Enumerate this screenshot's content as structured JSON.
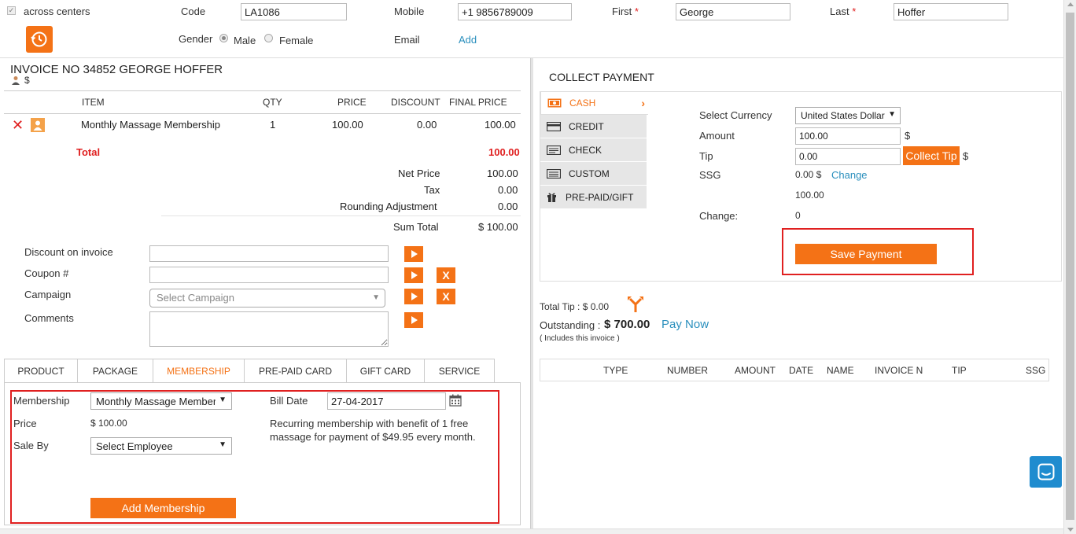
{
  "top": {
    "across_centers": "across centers",
    "code_label": "Code",
    "code_value": "LA1086",
    "mobile_label": "Mobile",
    "mobile_value": "+1 9856789009",
    "first_label": "First",
    "first_value": "George",
    "last_label": "Last",
    "last_value": "Hoffer",
    "required_mark": "*",
    "gender_label": "Gender",
    "male_label": "Male",
    "female_label": "Female",
    "email_label": "Email",
    "email_add": "Add"
  },
  "invoice": {
    "title": "INVOICE NO 34852  GEORGE HOFFER",
    "currency_symbol": "$",
    "columns": [
      "ITEM",
      "QTY",
      "PRICE",
      "DISCOUNT",
      "FINAL PRICE"
    ],
    "row": {
      "item": "Monthly Massage Membership",
      "qty": "1",
      "price": "100.00",
      "discount": "0.00",
      "final": "100.00"
    },
    "total_label": "Total",
    "total_value": "100.00",
    "net_price_label": "Net Price",
    "net_price_value": "100.00",
    "tax_label": "Tax",
    "tax_value": "0.00",
    "rounding_label": "Rounding Adjustment",
    "rounding_value": "0.00",
    "sum_total_label": "Sum Total",
    "sum_total_value": "$ 100.00"
  },
  "form": {
    "discount_label": "Discount on invoice",
    "coupon_label": "Coupon #",
    "campaign_label": "Campaign",
    "campaign_placeholder": "Select Campaign",
    "comments_label": "Comments",
    "x": "X"
  },
  "tabs": [
    "PRODUCT",
    "PACKAGE",
    "MEMBERSHIP",
    "PRE-PAID CARD",
    "GIFT CARD",
    "SERVICE"
  ],
  "membership": {
    "membership_label": "Membership",
    "membership_value": "Monthly Massage Membership",
    "bill_date_label": "Bill Date",
    "bill_date_value": "27-04-2017",
    "price_label": "Price",
    "price_value": "$ 100.00",
    "description": "Recurring membership with benefit of 1 free massage for payment of $49.95 every month.",
    "sale_by_label": "Sale By",
    "sale_by_value": "Select Employee",
    "add_button": "Add Membership"
  },
  "payment": {
    "title": "COLLECT PAYMENT",
    "methods": [
      "CASH",
      "CREDIT",
      "CHECK",
      "CUSTOM",
      "PRE-PAID/GIFT"
    ],
    "currency_label": "Select Currency",
    "currency_value": "United States Dollar",
    "amount_label": "Amount",
    "amount_value": "100.00",
    "dollar": "$",
    "tip_label": "Tip",
    "tip_value": "0.00",
    "collect_tip": "Collect Tip",
    "ssg_label": "SSG",
    "ssg_value": "0.00 $",
    "ssg_change": "Change",
    "ssg_total": "100.00",
    "change_label": "Change:",
    "change_value": "0",
    "save_button": "Save Payment",
    "total_tip": "Total Tip : $ 0.00",
    "outstanding_label": "Outstanding :",
    "outstanding_value": "$ 700.00",
    "pay_now": "Pay Now",
    "includes_note": "( Includes this invoice )",
    "columns": [
      "TYPE",
      "NUMBER",
      "AMOUNT",
      "DATE",
      "NAME",
      "INVOICE NO",
      "TIP",
      "SSG"
    ]
  },
  "colors": {
    "accent": "#f47216",
    "link": "#2a8fbd",
    "highlight": "#e02020"
  }
}
